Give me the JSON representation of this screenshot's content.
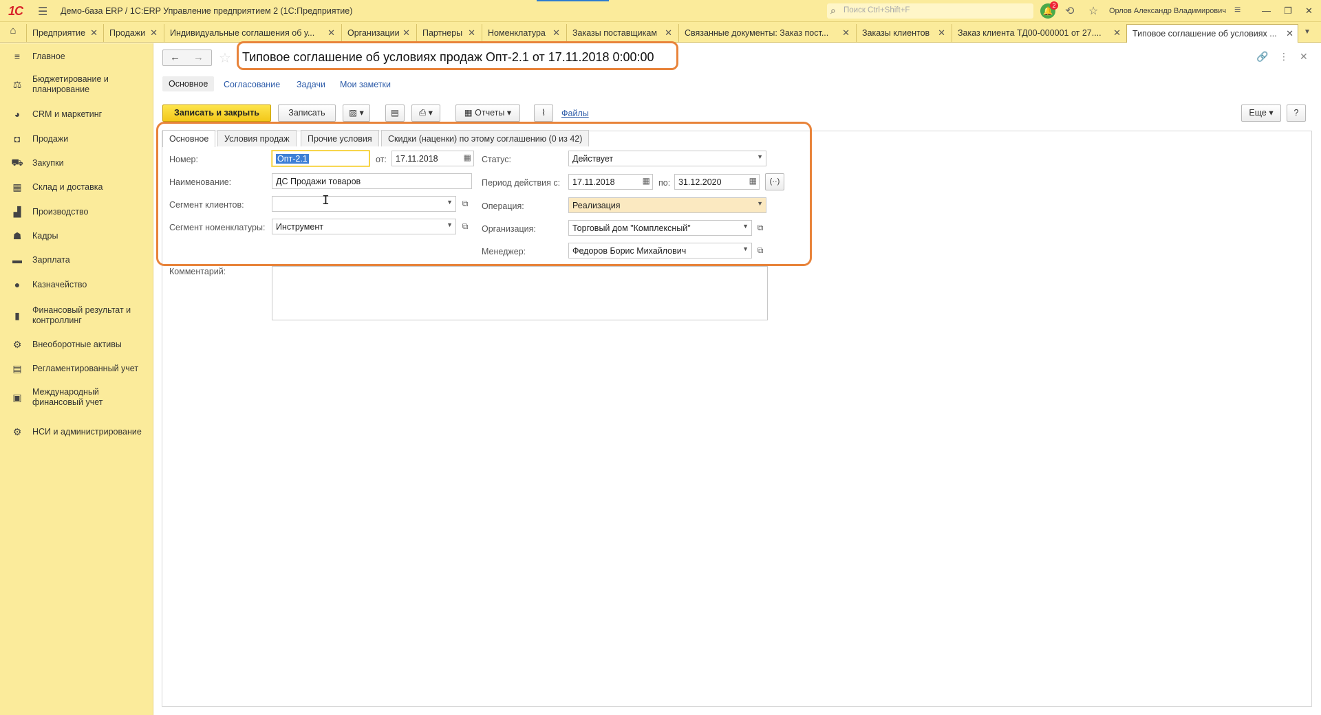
{
  "titlebar": {
    "logo": "1С",
    "app_title": "Демо-база ERP / 1С:ERP Управление предприятием 2  (1С:Предприятие)",
    "search_placeholder": "Поиск Ctrl+Shift+F",
    "notifications_count": "2",
    "user": "Орлов Александр Владимирович"
  },
  "tabs": [
    {
      "label": "Предприятие"
    },
    {
      "label": "Продажи"
    },
    {
      "label": "Индивидуальные соглашения об у..."
    },
    {
      "label": "Организации"
    },
    {
      "label": "Партнеры"
    },
    {
      "label": "Номенклатура"
    },
    {
      "label": "Заказы поставщикам"
    },
    {
      "label": "Связанные документы: Заказ пост..."
    },
    {
      "label": "Заказы клиентов"
    },
    {
      "label": "Заказ клиента ТД00-000001 от 27...."
    },
    {
      "label": "Типовое соглашение об условиях ..."
    }
  ],
  "sidebar": {
    "items": [
      {
        "label": "Главное",
        "icon": "menu-icon"
      },
      {
        "label": "Бюджетирование и планирование",
        "icon": "budget-icon"
      },
      {
        "label": "CRM и маркетинг",
        "icon": "pie-chart-icon"
      },
      {
        "label": "Продажи",
        "icon": "bag-icon"
      },
      {
        "label": "Закупки",
        "icon": "cart-icon"
      },
      {
        "label": "Склад и доставка",
        "icon": "warehouse-icon"
      },
      {
        "label": "Производство",
        "icon": "factory-icon"
      },
      {
        "label": "Кадры",
        "icon": "person-icon"
      },
      {
        "label": "Зарплата",
        "icon": "wallet-icon"
      },
      {
        "label": "Казначейство",
        "icon": "coin-icon"
      },
      {
        "label": "Финансовый результат и контроллинг",
        "icon": "bar-chart-icon"
      },
      {
        "label": "Внеоборотные активы",
        "icon": "assets-icon"
      },
      {
        "label": "Регламентированный учет",
        "icon": "ledger-icon"
      },
      {
        "label": "Международный финансовый учет",
        "icon": "intl-ledger-icon"
      },
      {
        "label": "НСИ и администрирование",
        "icon": "gear-icon"
      }
    ]
  },
  "document": {
    "title": "Типовое соглашение об условиях продаж Опт-2.1 от 17.11.2018 0:00:00"
  },
  "subnav": {
    "main": "Основное",
    "approval": "Согласование",
    "tasks": "Задачи",
    "notes": "Мои заметки"
  },
  "toolbar": {
    "save_close": "Записать и закрыть",
    "save": "Записать",
    "reports": "Отчеты",
    "files": "Файлы",
    "more": "Еще",
    "help": "?"
  },
  "form_tabs": [
    {
      "label": "Основное"
    },
    {
      "label": "Условия продаж"
    },
    {
      "label": "Прочие условия"
    },
    {
      "label": "Скидки (наценки) по этому соглашению (0 из 42)"
    }
  ],
  "form": {
    "number_label": "Номер:",
    "number_value": "Опт-2.1",
    "date_label": "от:",
    "date_value": "17.11.2018",
    "name_label": "Наименование:",
    "name_value": "ДС Продажи товаров",
    "client_segment_label": "Сегмент клиентов:",
    "client_segment_value": "",
    "item_segment_label": "Сегмент номенклатуры:",
    "item_segment_value": "Инструмент",
    "status_label": "Статус:",
    "status_value": "Действует",
    "period_label": "Период действия с:",
    "period_from": "17.11.2018",
    "period_to_label": "по:",
    "period_to": "31.12.2020",
    "operation_label": "Операция:",
    "operation_value": "Реализация",
    "organization_label": "Организация:",
    "organization_value": "Торговый дом \"Комплексный\"",
    "manager_label": "Менеджер:",
    "manager_value": "Федоров Борис Михайлович",
    "comment_label": "Комментарий:"
  },
  "colors": {
    "panel": "#fbeb9b",
    "highlight": "#e8833a",
    "primary_button": "#f3c81a",
    "link": "#2b5aa8"
  }
}
